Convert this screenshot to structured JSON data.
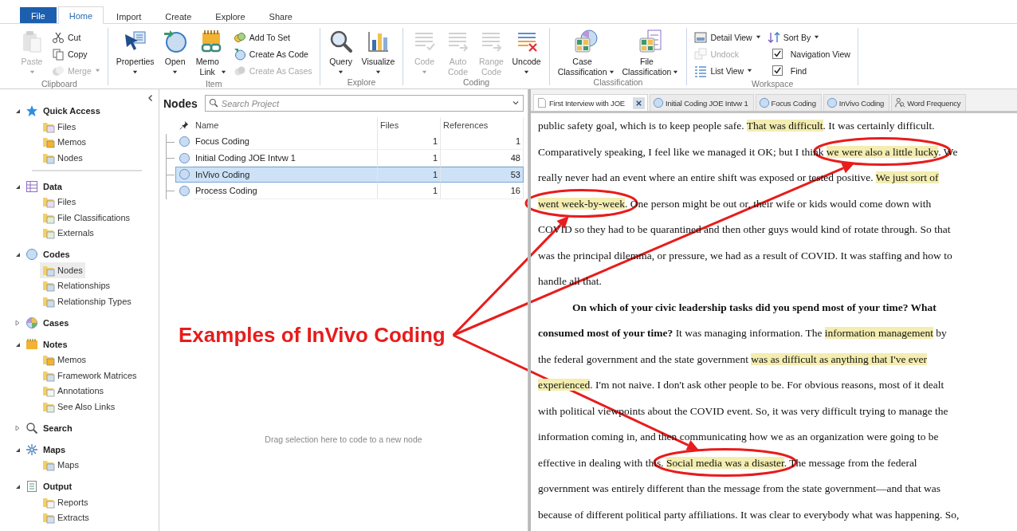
{
  "ribbon": {
    "tabs": [
      {
        "label": "File",
        "kind": "file",
        "selected": false
      },
      {
        "label": "Home",
        "kind": "tab",
        "selected": true
      },
      {
        "label": "Import",
        "kind": "tab",
        "selected": false
      },
      {
        "label": "Create",
        "kind": "tab",
        "selected": false
      },
      {
        "label": "Explore",
        "kind": "tab",
        "selected": false
      },
      {
        "label": "Share",
        "kind": "tab",
        "selected": false
      }
    ],
    "groups": [
      {
        "label": "Clipboard",
        "items": [
          {
            "kind": "large",
            "label": "Paste",
            "disabled": true,
            "dropdown": true
          },
          {
            "kind": "small",
            "label": "Cut",
            "disabled": false,
            "dropdown": false
          },
          {
            "kind": "small",
            "label": "Copy",
            "disabled": false,
            "dropdown": false
          },
          {
            "kind": "small",
            "label": "Merge",
            "disabled": true,
            "dropdown": true
          }
        ]
      },
      {
        "label": "Item",
        "items": [
          {
            "kind": "large",
            "label": "Properties",
            "disabled": false,
            "dropdown": true
          },
          {
            "kind": "large",
            "label": "Open",
            "disabled": false,
            "dropdown": true
          },
          {
            "kind": "large",
            "label": "Memo Link",
            "disabled": false,
            "dropdown": true
          },
          {
            "kind": "small",
            "label": "Add To Set",
            "disabled": false,
            "dropdown": false
          },
          {
            "kind": "small",
            "label": "Create As Code",
            "disabled": false,
            "dropdown": false
          },
          {
            "kind": "small",
            "label": "Create As Cases",
            "disabled": true,
            "dropdown": false
          }
        ]
      },
      {
        "label": "Explore",
        "items": [
          {
            "kind": "large",
            "label": "Query",
            "disabled": false,
            "dropdown": true
          },
          {
            "kind": "large",
            "label": "Visualize",
            "disabled": false,
            "dropdown": true
          }
        ]
      },
      {
        "label": "Coding",
        "items": [
          {
            "kind": "large",
            "label": "Code",
            "disabled": true,
            "dropdown": true
          },
          {
            "kind": "large",
            "label": "Auto Code",
            "disabled": true,
            "dropdown": false
          },
          {
            "kind": "large",
            "label": "Range Code",
            "disabled": true,
            "dropdown": false
          },
          {
            "kind": "large",
            "label": "Uncode",
            "disabled": false,
            "dropdown": true
          }
        ]
      },
      {
        "label": "Classification",
        "items": [
          {
            "kind": "large",
            "label": "Case Classification",
            "disabled": false,
            "dropdown": true
          },
          {
            "kind": "large",
            "label": "File Classification",
            "disabled": false,
            "dropdown": true
          }
        ]
      },
      {
        "label": "Workspace",
        "items": [
          {
            "kind": "small",
            "label": "Detail View",
            "disabled": false,
            "dropdown": true
          },
          {
            "kind": "small",
            "label": "Undock",
            "disabled": true,
            "dropdown": false
          },
          {
            "kind": "small",
            "label": "List View",
            "disabled": false,
            "dropdown": true
          },
          {
            "kind": "small",
            "label": "Sort By",
            "disabled": false,
            "dropdown": true
          },
          {
            "kind": "check",
            "label": "Navigation View",
            "disabled": false,
            "checked": true
          },
          {
            "kind": "check",
            "label": "Find",
            "disabled": false,
            "checked": true
          }
        ]
      }
    ]
  },
  "navigation": {
    "quick_access": {
      "label": "Quick Access",
      "expanded": true,
      "children": [
        {
          "label": "Files",
          "selected": false
        },
        {
          "label": "Memos",
          "selected": false
        },
        {
          "label": "Nodes",
          "selected": false
        }
      ]
    },
    "sections": [
      {
        "label": "Data",
        "expanded": true,
        "children": [
          {
            "label": "Files",
            "selected": false
          },
          {
            "label": "File Classifications",
            "selected": false
          },
          {
            "label": "Externals",
            "selected": false
          }
        ]
      },
      {
        "label": "Codes",
        "expanded": true,
        "children": [
          {
            "label": "Nodes",
            "selected": true
          },
          {
            "label": "Relationships",
            "selected": false
          },
          {
            "label": "Relationship Types",
            "selected": false
          }
        ]
      },
      {
        "label": "Cases",
        "expanded": false
      },
      {
        "label": "Notes",
        "expanded": true,
        "children": [
          {
            "label": "Memos",
            "selected": false
          },
          {
            "label": "Framework Matrices",
            "selected": false
          },
          {
            "label": "Annotations",
            "selected": false
          },
          {
            "label": "See Also Links",
            "selected": false
          }
        ]
      },
      {
        "label": "Search",
        "expanded": false
      },
      {
        "label": "Maps",
        "expanded": true,
        "children": [
          {
            "label": "Maps",
            "selected": false
          }
        ]
      },
      {
        "label": "Output",
        "expanded": true,
        "children": [
          {
            "label": "Reports",
            "selected": false
          },
          {
            "label": "Extracts",
            "selected": false
          }
        ]
      }
    ]
  },
  "nodes_panel": {
    "title": "Nodes",
    "search": {
      "placeholder": "Search Project"
    },
    "table": {
      "columns": [
        "Name",
        "Files",
        "References"
      ],
      "rows": [
        {
          "name": "Focus Coding",
          "files": "1",
          "references": "1",
          "selected": false
        },
        {
          "name": "Initial Coding JOE Intvw 1",
          "files": "1",
          "references": "48",
          "selected": false
        },
        {
          "name": "InVivo Coding",
          "files": "1",
          "references": "53",
          "selected": true
        },
        {
          "name": "Process Coding",
          "files": "1",
          "references": "16",
          "selected": false
        }
      ]
    },
    "drop_hint": "Drag selection here to code to a new node"
  },
  "document_tabs": [
    {
      "label": "First Interview with JOE",
      "kind": "document",
      "selected": true
    },
    {
      "label": "Initial Coding JOE Intvw 1",
      "kind": "node",
      "selected": false
    },
    {
      "label": "Focus Coding",
      "kind": "node",
      "selected": false
    },
    {
      "label": "InVivo Coding",
      "kind": "node",
      "selected": false
    },
    {
      "label": "Word Frequency",
      "kind": "query",
      "selected": false
    }
  ],
  "document": {
    "lines": [
      {
        "indent": false,
        "segments": [
          {
            "text": "public safety goal, which is to keep people safe. ",
            "highlighted": false,
            "bold": false
          },
          {
            "text": "That was difficult",
            "highlighted": true,
            "bold": false
          },
          {
            "text": ". It was certainly difficult.",
            "highlighted": false,
            "bold": false
          }
        ]
      },
      {
        "indent": false,
        "segments": [
          {
            "text": "Comparatively speaking, I feel like we managed it OK; but I think ",
            "highlighted": false,
            "bold": false
          },
          {
            "text": "we were also a little lucky",
            "highlighted": true,
            "bold": false,
            "circled": true
          },
          {
            "text": ". We",
            "highlighted": false,
            "bold": false
          }
        ]
      },
      {
        "indent": false,
        "segments": [
          {
            "text": "really never had an event where an entire shift was exposed or tested positive. ",
            "highlighted": false,
            "bold": false
          },
          {
            "text": "We just sort of",
            "highlighted": true,
            "bold": false
          }
        ]
      },
      {
        "indent": false,
        "segments": [
          {
            "text": "went week-by-week",
            "highlighted": true,
            "bold": false,
            "circled": true
          },
          {
            "text": ". One person might be out or, their wife or kids would come down with",
            "highlighted": false,
            "bold": false
          }
        ]
      },
      {
        "indent": false,
        "segments": [
          {
            "text": "COVID so they had to be quarantined and then other guys would kind of rotate through. So that",
            "highlighted": false,
            "bold": false
          }
        ]
      },
      {
        "indent": false,
        "segments": [
          {
            "text": "was the principal dilemma, or pressure, we had as a result of COVID. It was staffing and how to",
            "highlighted": false,
            "bold": false
          }
        ]
      },
      {
        "indent": false,
        "segments": [
          {
            "text": "handle all that.",
            "highlighted": false,
            "bold": false
          }
        ]
      },
      {
        "indent": true,
        "segments": [
          {
            "text": "On which of your civic leadership tasks did you spend most of your time? What",
            "highlighted": false,
            "bold": true
          }
        ]
      },
      {
        "indent": false,
        "segments": [
          {
            "text": "consumed most of your time?",
            "highlighted": false,
            "bold": true
          },
          {
            "text": " It was managing information. The ",
            "highlighted": false,
            "bold": false
          },
          {
            "text": "information management",
            "highlighted": true,
            "bold": false
          },
          {
            "text": " by",
            "highlighted": false,
            "bold": false
          }
        ]
      },
      {
        "indent": false,
        "segments": [
          {
            "text": "the federal government and the state government ",
            "highlighted": false,
            "bold": false
          },
          {
            "text": "was as difficult as anything that I've ever",
            "highlighted": true,
            "bold": false
          }
        ]
      },
      {
        "indent": false,
        "segments": [
          {
            "text": "experienced",
            "highlighted": true,
            "bold": false
          },
          {
            "text": ". I'm not naive. I don't ask other people to be. For obvious reasons, most of it dealt",
            "highlighted": false,
            "bold": false
          }
        ]
      },
      {
        "indent": false,
        "segments": [
          {
            "text": "with political viewpoints about the COVID event. So, it was very difficult trying to manage the",
            "highlighted": false,
            "bold": false
          }
        ]
      },
      {
        "indent": false,
        "segments": [
          {
            "text": "information coming in, and then communicating how we as an organization were going to be",
            "highlighted": false,
            "bold": false
          }
        ]
      },
      {
        "indent": false,
        "segments": [
          {
            "text": "effective in dealing with this. ",
            "highlighted": false,
            "bold": false
          },
          {
            "text": "Social media was a disaster",
            "highlighted": true,
            "bold": false,
            "circled": true
          },
          {
            "text": ". The message from the federal",
            "highlighted": false,
            "bold": false
          }
        ]
      },
      {
        "indent": false,
        "segments": [
          {
            "text": "government was entirely different than the message from the state government—and that was",
            "highlighted": false,
            "bold": false
          }
        ]
      },
      {
        "indent": false,
        "segments": [
          {
            "text": "because of different political party affiliations. It was clear to everybody what was happening. So,",
            "highlighted": false,
            "bold": false
          }
        ]
      }
    ]
  },
  "annotation": {
    "label": "Examples of InVivo Coding"
  }
}
